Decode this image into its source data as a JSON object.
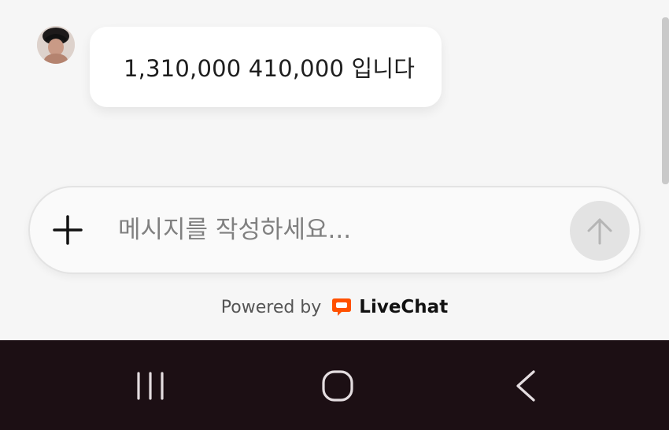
{
  "conversation": {
    "messages": [
      {
        "text": "1,310,000 410,000 입니다",
        "avatar_icon": "user-avatar"
      }
    ]
  },
  "composer": {
    "placeholder": "메시지를 작성하세요...",
    "value": "",
    "attach_icon": "plus-icon",
    "send_icon": "arrow-up-icon"
  },
  "footer": {
    "powered_by": "Powered by",
    "brand_name": "LiveChat",
    "brand_icon": "livechat-logo-icon",
    "brand_color": "#ff5100"
  },
  "navbar": {
    "recents_icon": "recent-apps-icon",
    "home_icon": "home-icon",
    "back_icon": "back-icon",
    "background": "#1c0f14"
  }
}
